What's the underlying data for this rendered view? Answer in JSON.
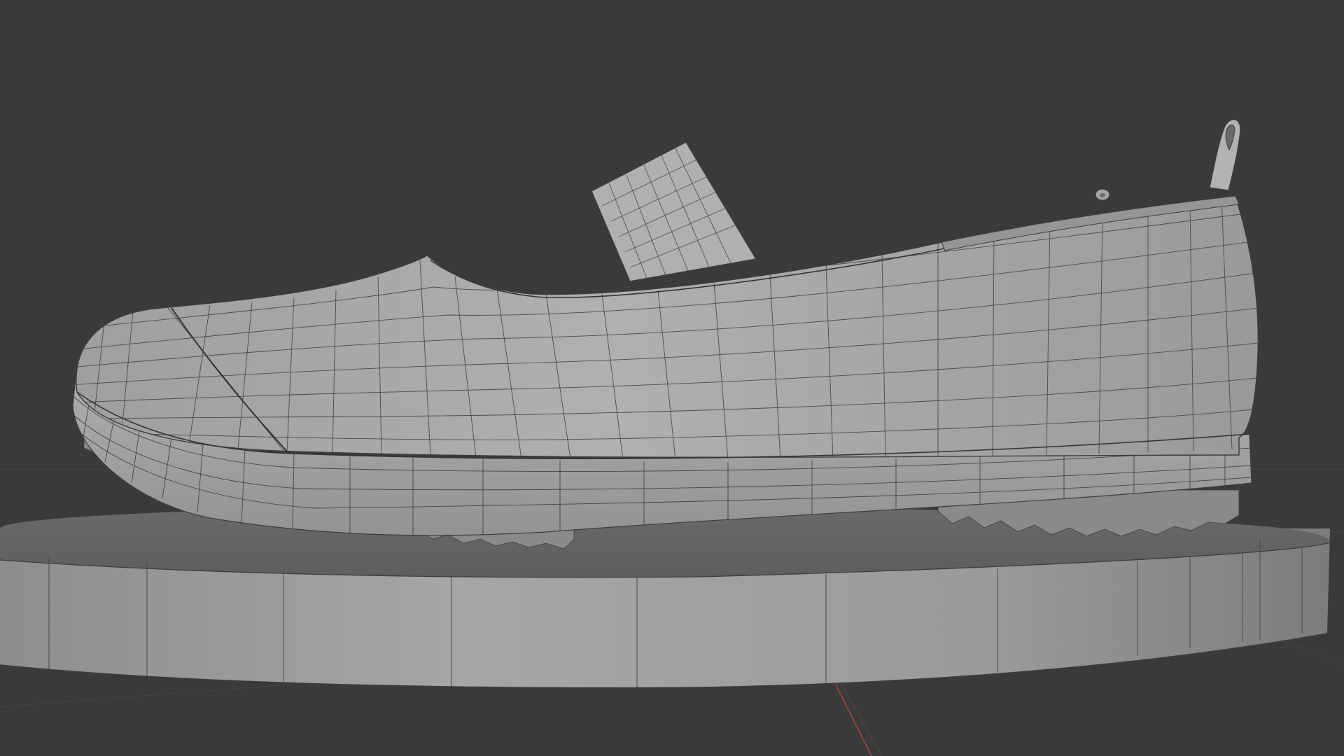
{
  "viewport": {
    "background": "#3a3a3a",
    "mode": "wireframe-overlay",
    "objects": [
      {
        "name": "shoe",
        "kind": "mesh"
      },
      {
        "name": "pedestal",
        "kind": "cylinder"
      }
    ]
  },
  "colors": {
    "mesh_face": "#a9a9a9",
    "wire": "#3c3c3c",
    "x_axis": "#b84848",
    "grid": "#444444"
  }
}
